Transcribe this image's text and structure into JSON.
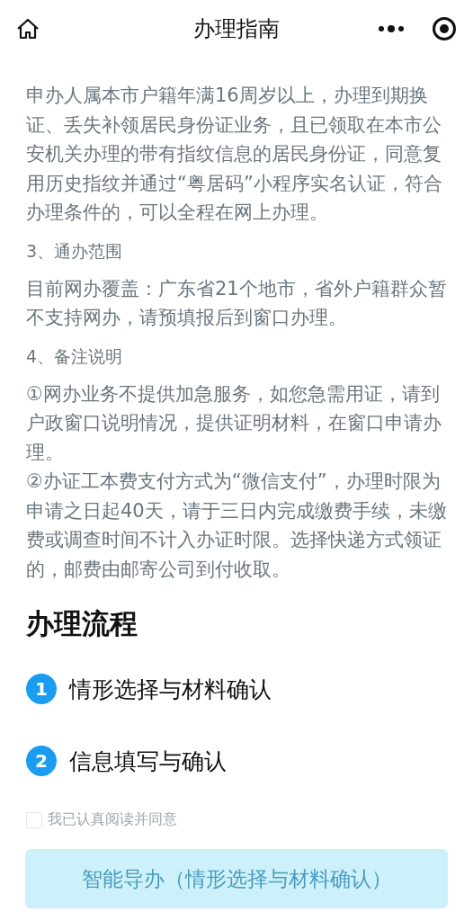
{
  "header": {
    "title": "办理指南"
  },
  "sections": [
    {
      "paragraphs": [
        "申办人属本市户籍年满16周岁以上，办理到期换证、丢失补领居民身份证业务，且已领取在本市公安机关办理的带有指纹信息的居民身份证，同意复用历史指纹并通过“粤居码”小程序实名认证，符合办理条件的，可以全程在网上办理。"
      ]
    },
    {
      "heading": "3、通办范围",
      "paragraphs": [
        "目前网办覆盖：广东省21个地市，省外户籍群众暂不支持网办，请预填报后到窗口办理。"
      ]
    },
    {
      "heading": "4、备注说明",
      "paragraphs": [
        "①网办业务不提供加急服务，如您急需用证，请到户政窗口说明情况，提供证明材料，在窗口申请办理。",
        "②办证工本费支付方式为“微信支付”，办理时限为申请之日起40天，请于三日内完成缴费手续，未缴费或调查时间不计入办证时限。选择快递方式领证的，邮费由邮寄公司到付收取。"
      ]
    }
  ],
  "process": {
    "title": "办理流程",
    "steps": [
      {
        "number": "1",
        "label": "情形选择与材料确认"
      },
      {
        "number": "2",
        "label": "信息填写与确认"
      }
    ]
  },
  "agreement": {
    "label": "我已认真阅读并同意",
    "checked": false
  },
  "button": {
    "label": "智能导办（情形选择与材料确认）",
    "disabled": true
  }
}
